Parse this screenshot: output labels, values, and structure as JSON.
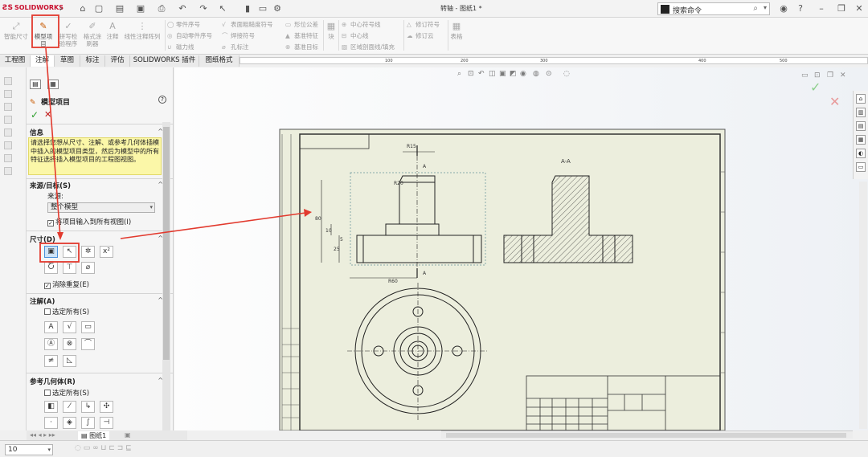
{
  "app": {
    "logo_text": "SOLIDWORKS",
    "title": "转轴 - 图纸1 *"
  },
  "search": {
    "placeholder": "搜索命令"
  },
  "commands": {
    "smart_dim": "智能尺寸",
    "model_items_line1": "模型项",
    "model_items_line2": "目",
    "spell_line1": "拼写检",
    "spell_line2": "验程序",
    "format_line1": "格式涂",
    "format_line2": "刷器",
    "note": "注释",
    "linear_note_pattern": "线性注释阵列",
    "balloon": "零件序号",
    "auto_balloon": "自动零件序号",
    "magnetic_line": "磁力线",
    "surface_finish": "表面粗糙度符号",
    "weld_symbol": "焊接符号",
    "hole_callout": "孔标注",
    "geo_tol": "形位公差",
    "datum_feature": "基准特征",
    "datum_target": "基准目标",
    "block": "块",
    "center_mark": "中心符号线",
    "centerline": "中心线",
    "area_hatch": "区域剖面线/填充",
    "rev_symbol": "修订符号",
    "rev_cloud": "修订云",
    "tables": "表格"
  },
  "tabs": [
    "工程图",
    "注解",
    "草图",
    "标注",
    "评估",
    "SOLIDWORKS 插件",
    "图纸格式"
  ],
  "ruler_ticks": [
    "100",
    "200",
    "300",
    "400",
    "500"
  ],
  "pm": {
    "title": "模型项目",
    "help": "?",
    "info_header": "信息",
    "info_text": "请选择您想从尺寸、注解、或参考几何体插模中插入的模型项目类型，然后为模型中的所有特征选择插入模型项目的工程图视图。",
    "source_header": "来源/目标(S)",
    "source_label": "来源:",
    "source_value": "整个模型",
    "import_all_views": "将项目输入到所有视图(I)",
    "dims_header": "尺寸(D)",
    "eliminate_dup": "消除重复(E)",
    "annotations_header": "注解(A)",
    "select_all_ann": "选定所有(S)",
    "ref_geom_header": "参考几何体(R)",
    "select_all_ref": "选定所有(S)"
  },
  "sheet_tab": "图纸1",
  "zoom": "10",
  "drawing": {
    "view_label": "A-A",
    "dim_r15": "R15",
    "dim_r20": "R20",
    "dim_r60": "R60",
    "dim_80": "80",
    "dim_10": "10",
    "dim_25": "25",
    "dim_5": "5",
    "section_a": "A"
  }
}
